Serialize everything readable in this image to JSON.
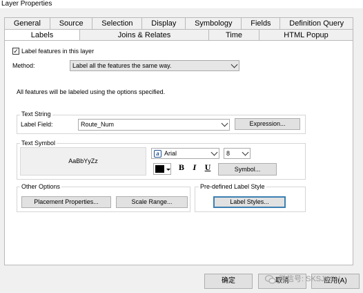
{
  "window": {
    "title": "Layer Properties"
  },
  "tabs": {
    "row1": [
      "General",
      "Source",
      "Selection",
      "Display",
      "Symbology",
      "Fields",
      "Definition Query"
    ],
    "row2": [
      "Labels",
      "Joins & Relates",
      "Time",
      "HTML Popup"
    ],
    "active": "Labels"
  },
  "labels_tab": {
    "label_features_checkbox": {
      "label": "Label features in this layer",
      "checked": true
    },
    "method": {
      "label": "Method:",
      "value": "Label all the features the same way."
    },
    "info": "All features will be labeled using the options specified.",
    "text_string": {
      "group_label": "Text String",
      "field_label": "Label Field:",
      "field_value": "Route_Num",
      "expression_button": "Expression..."
    },
    "text_symbol": {
      "group_label": "Text Symbol",
      "preview_text": "AaBbYyZz",
      "font_icon": "opentype-font-icon",
      "font_name": "Arial",
      "font_size": "8",
      "color": "#000000",
      "bold": "B",
      "italic": "I",
      "underline": "U",
      "symbol_button": "Symbol..."
    },
    "other_options": {
      "group_label": "Other Options",
      "placement_button": "Placement Properties...",
      "scale_button": "Scale Range..."
    },
    "predefined": {
      "group_label": "Pre-defined Label Style",
      "label_styles_button": "Label Styles..."
    }
  },
  "footer": {
    "ok": "确定",
    "cancel": "取消",
    "apply": "应用(A)"
  },
  "watermark": {
    "icon": "wechat-icon",
    "text": "微信号: SKSJKSH"
  }
}
